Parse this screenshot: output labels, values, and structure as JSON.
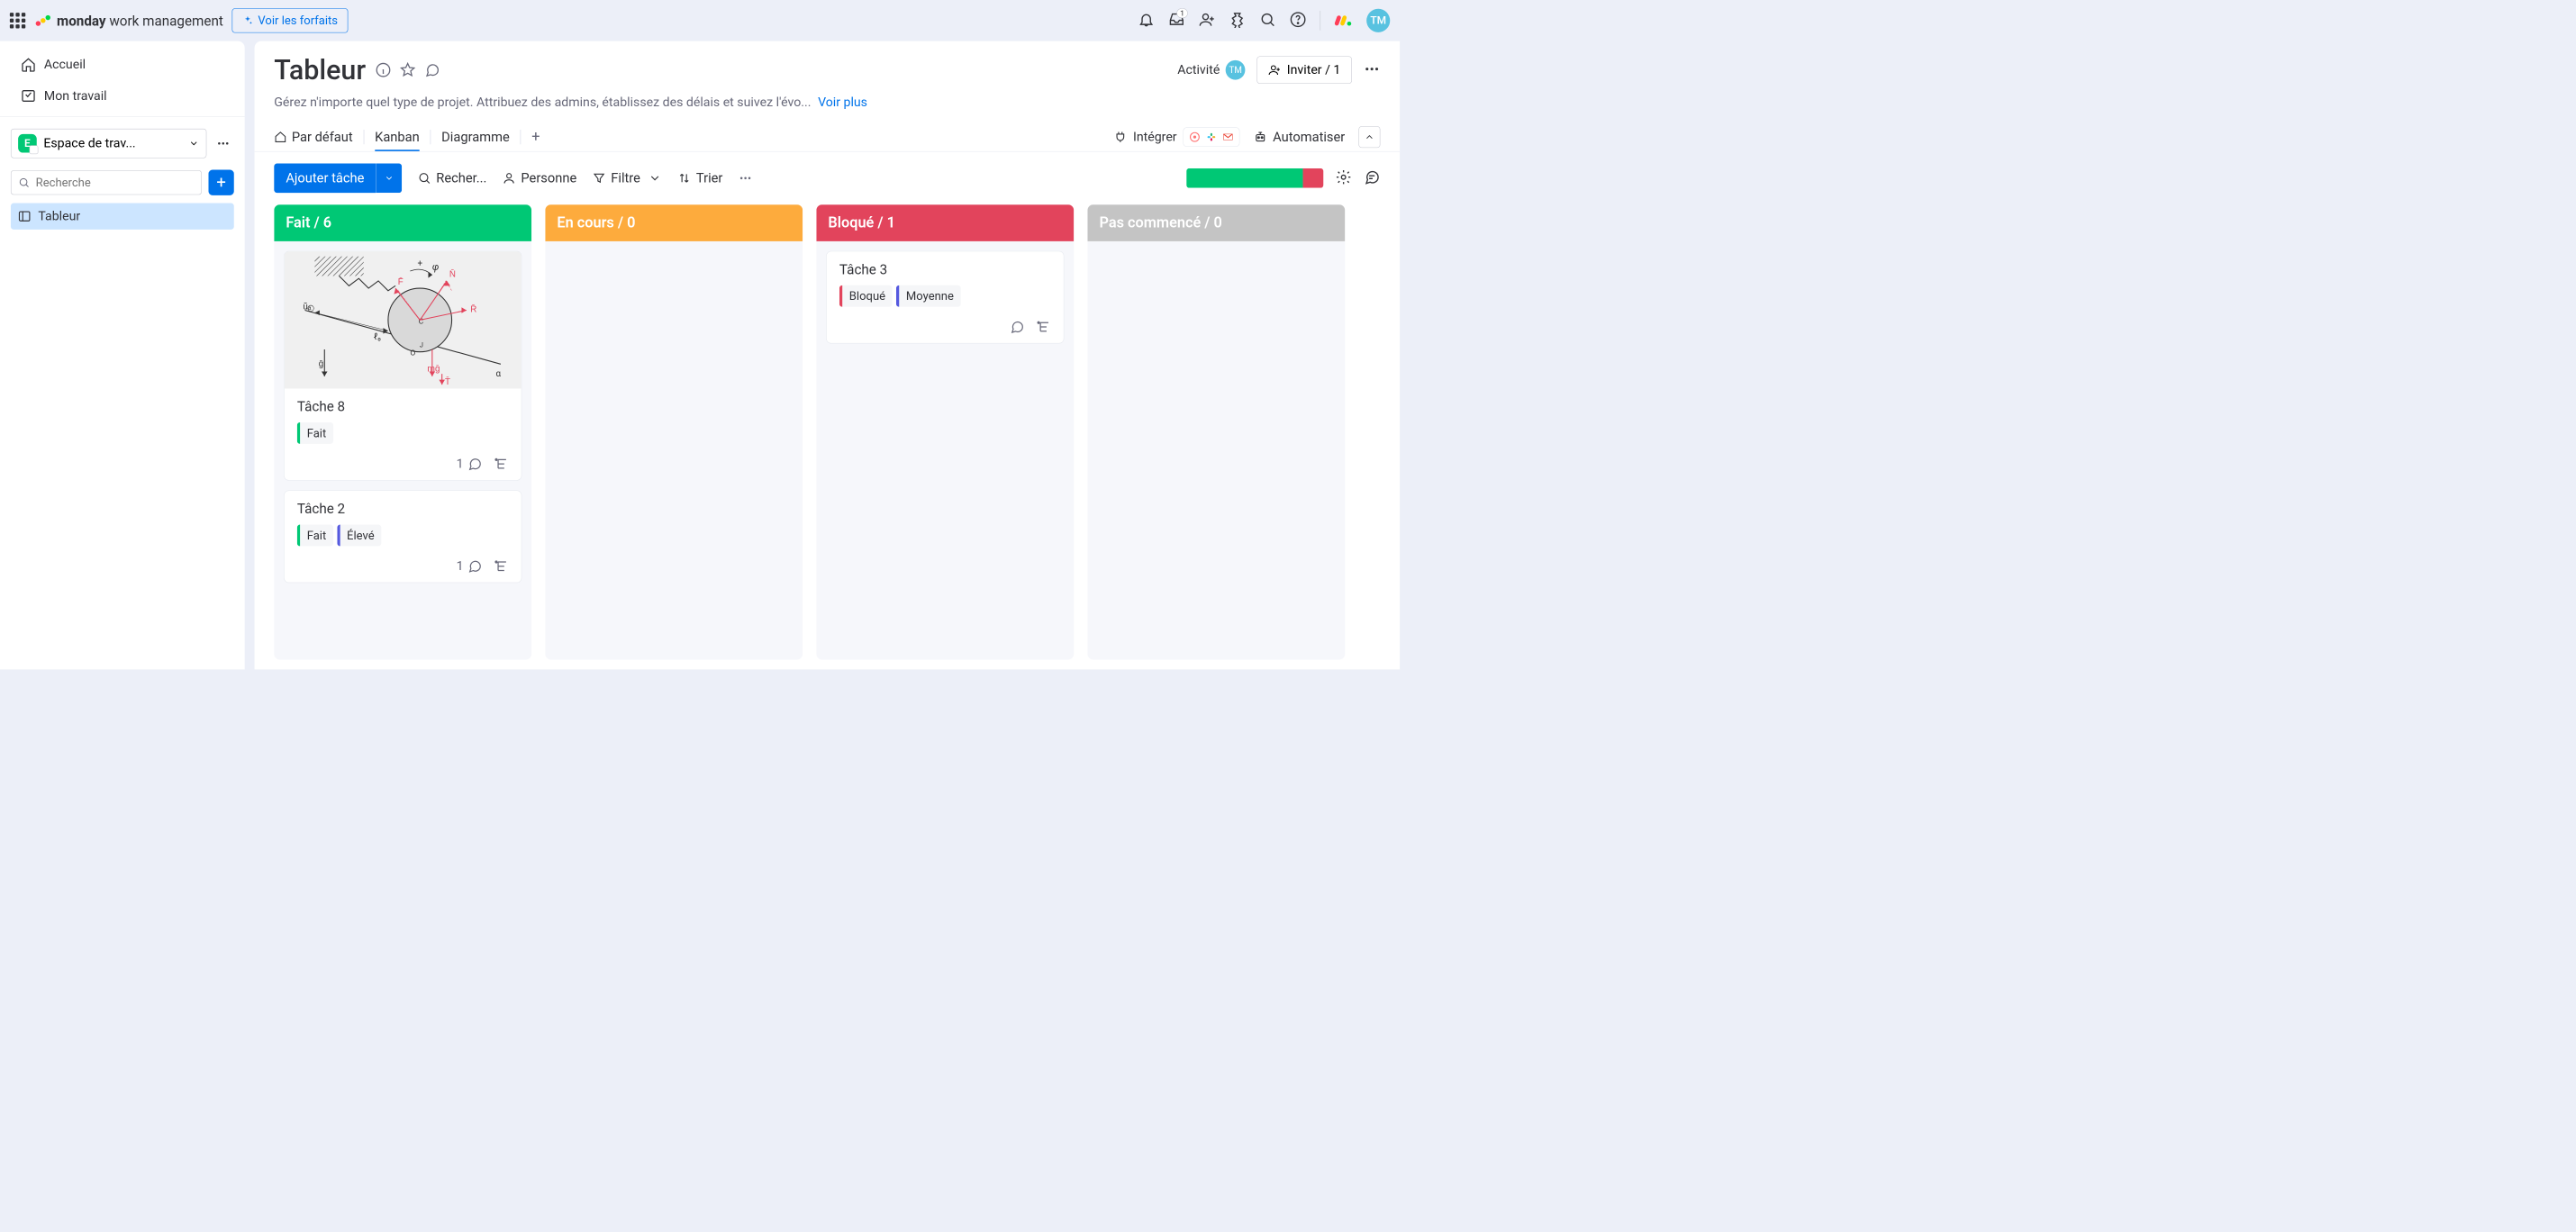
{
  "topbar": {
    "brand_bold": "monday",
    "brand_rest": "work management",
    "plans_label": "Voir les forfaits",
    "inbox_badge": "1",
    "avatar_initials": "TM"
  },
  "sidebar": {
    "home_label": "Accueil",
    "mywork_label": "Mon travail",
    "workspace_label": "Espace de trav...",
    "workspace_initial": "E",
    "search_placeholder": "Recherche",
    "board_item": "Tableur"
  },
  "header": {
    "board_title": "Tableur",
    "description": "Gérez n'importe quel type de projet. Attribuez des admins, établissez des délais et suivez l'évo...",
    "see_more": "Voir plus",
    "activity_label": "Activité",
    "activity_initials": "TM",
    "invite_label": "Inviter / 1"
  },
  "tabs": {
    "default": "Par défaut",
    "kanban": "Kanban",
    "diagram": "Diagramme",
    "integrate": "Intégrer",
    "automate": "Automatiser"
  },
  "toolbar": {
    "add_task": "Ajouter tâche",
    "search": "Recher...",
    "person": "Personne",
    "filter": "Filtre",
    "sort": "Trier"
  },
  "progress": {
    "done_pct": 85,
    "blocked_pct": 15
  },
  "kanban": {
    "columns": [
      {
        "key": "done",
        "title": "Fait / 6",
        "color": "#00c875"
      },
      {
        "key": "inprogress",
        "title": "En cours / 0",
        "color": "#fdab3d"
      },
      {
        "key": "blocked",
        "title": "Bloqué / 1",
        "color": "#e2445c"
      },
      {
        "key": "notstarted",
        "title": "Pas commencé / 0",
        "color": "#c4c4c4"
      }
    ],
    "cards": {
      "done": [
        {
          "title": "Tâche 8",
          "has_image": true,
          "pills": [
            {
              "text": "Fait",
              "bar": "#00c875"
            }
          ],
          "comments": 1
        },
        {
          "title": "Tâche 2",
          "has_image": false,
          "pills": [
            {
              "text": "Fait",
              "bar": "#00c875"
            },
            {
              "text": "Élevé",
              "bar": "#5559df"
            }
          ],
          "comments": 1
        }
      ],
      "inprogress": [],
      "blocked": [
        {
          "title": "Tâche 3",
          "has_image": false,
          "pills": [
            {
              "text": "Bloqué",
              "bar": "#e2445c"
            },
            {
              "text": "Moyenne",
              "bar": "#5559df"
            }
          ],
          "comments": 0
        }
      ],
      "notstarted": []
    }
  }
}
